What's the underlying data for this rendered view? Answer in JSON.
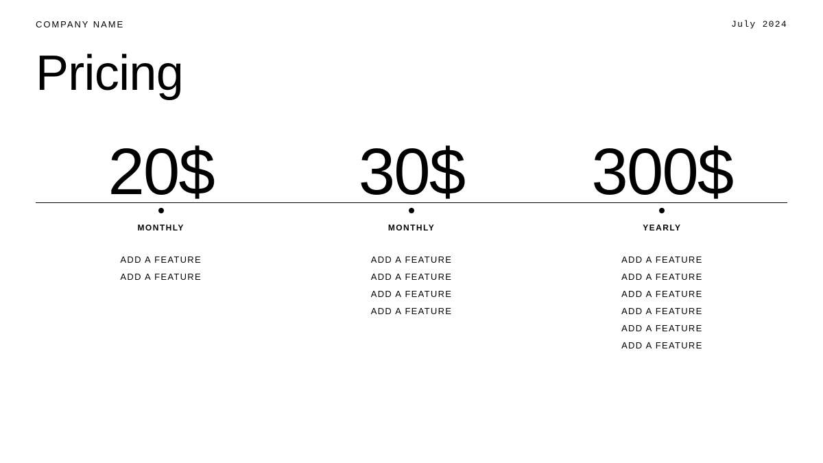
{
  "header": {
    "company_name": "COMPANY  NAME",
    "date": "July  2024"
  },
  "page_title": "Pricing",
  "plans": [
    {
      "price": "20$",
      "period": "MONTHLY",
      "features": [
        "ADD A FEATURE",
        "ADD A FEATURE"
      ]
    },
    {
      "price": "30$",
      "period": "MONTHLY",
      "features": [
        "ADD A FEATURE",
        "ADD A FEATURE",
        "ADD A FEATURE",
        "ADD A FEATURE"
      ]
    },
    {
      "price": "300$",
      "period": "YEARLY",
      "features": [
        "ADD A FEATURE",
        "ADD A FEATURE",
        "ADD A FEATURE",
        "ADD A FEATURE",
        "ADD A FEATURE",
        "ADD A FEATURE"
      ]
    }
  ]
}
